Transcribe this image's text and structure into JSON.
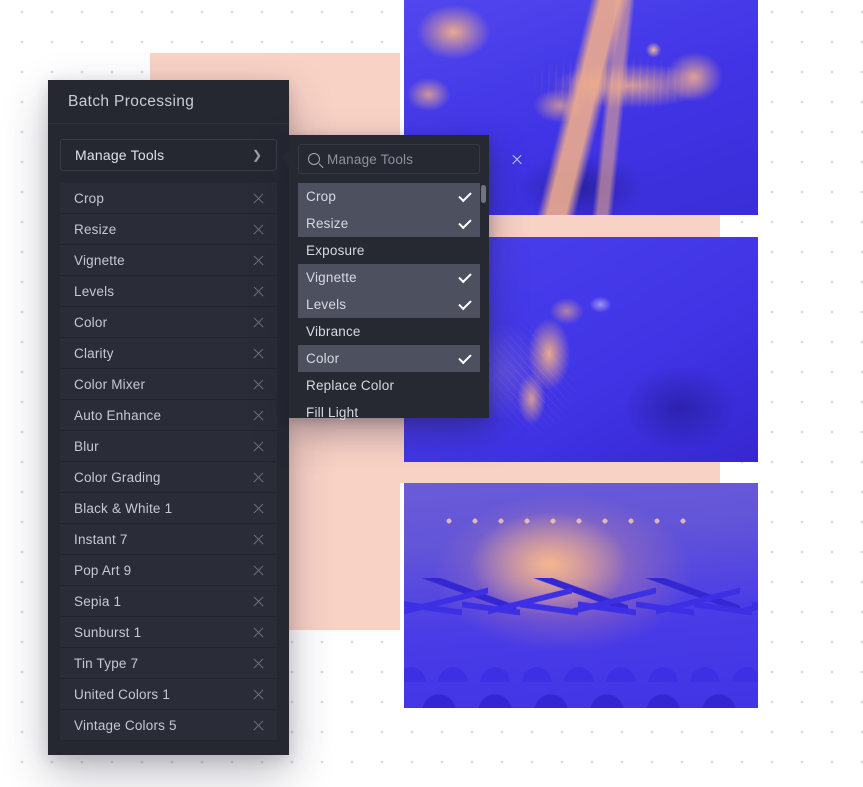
{
  "background": {
    "dot_color": "#d9dbe0",
    "page_color": "#ffffff",
    "accent_peach": "#f9d2c6",
    "accent_blue": "#4034e6"
  },
  "panel": {
    "title": "Batch Processing",
    "manage_tools": {
      "label": "Manage Tools",
      "chevron": "chevron-right-icon"
    },
    "remove_icon": "close-icon",
    "tools": [
      {
        "name": "Crop"
      },
      {
        "name": "Resize"
      },
      {
        "name": "Vignette"
      },
      {
        "name": "Levels"
      },
      {
        "name": "Color"
      },
      {
        "name": "Clarity"
      },
      {
        "name": "Color Mixer"
      },
      {
        "name": "Auto Enhance"
      },
      {
        "name": "Blur"
      },
      {
        "name": "Color Grading"
      },
      {
        "name": "Black & White 1"
      },
      {
        "name": "Instant 7"
      },
      {
        "name": "Pop Art 9"
      },
      {
        "name": "Sepia 1"
      },
      {
        "name": "Sunburst 1"
      },
      {
        "name": "Tin Type 7"
      },
      {
        "name": "United Colors 1"
      },
      {
        "name": "Vintage Colors 5"
      }
    ]
  },
  "dropdown": {
    "search": {
      "value": "",
      "placeholder": "Manage Tools",
      "search_icon": "search-icon",
      "clear_icon": "close-icon"
    },
    "check_icon": "check-icon",
    "options": [
      {
        "label": "Crop",
        "selected": true
      },
      {
        "label": "Resize",
        "selected": true
      },
      {
        "label": "Exposure",
        "selected": false
      },
      {
        "label": "Vignette",
        "selected": true
      },
      {
        "label": "Levels",
        "selected": true
      },
      {
        "label": "Vibrance",
        "selected": false
      },
      {
        "label": "Color",
        "selected": true
      },
      {
        "label": "Replace Color",
        "selected": false
      },
      {
        "label": "Fill Light",
        "selected": false
      }
    ]
  },
  "photos": [
    {
      "name": "guitar-player-photo"
    },
    {
      "name": "singer-with-microphone-photo"
    },
    {
      "name": "concert-crowd-photo"
    }
  ]
}
